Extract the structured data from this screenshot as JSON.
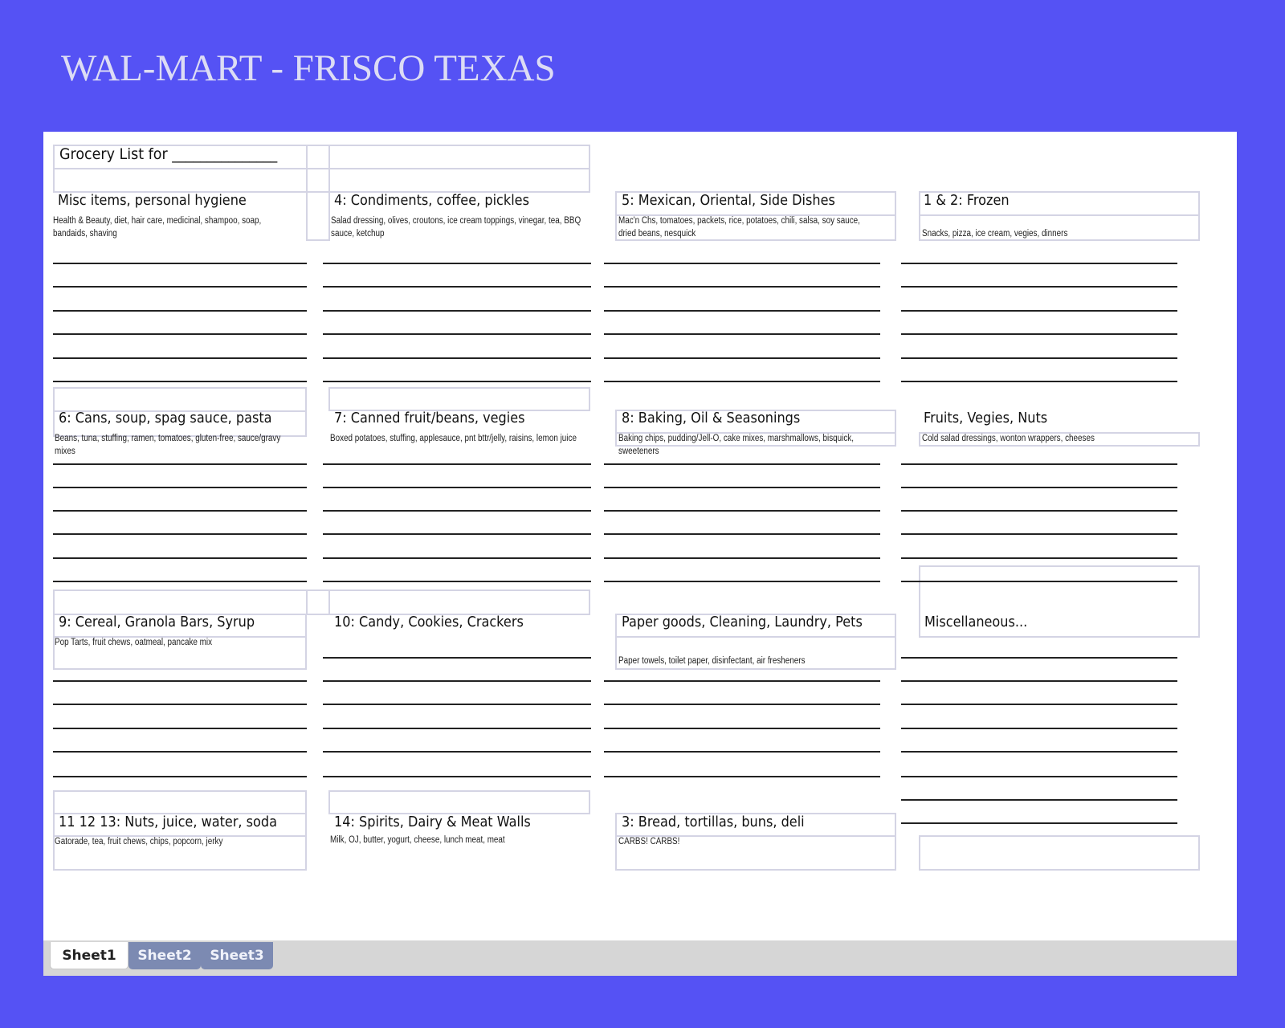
{
  "page_title": "WAL-MART - FRISCO TEXAS",
  "list_header": "Grocery List for _______________",
  "sections": {
    "misc_hygiene": {
      "title": "Misc items, personal hygiene",
      "desc": "Health & Beauty, diet, hair care, medicinal, shampoo, soap, bandaids, shaving"
    },
    "condiments": {
      "title": "4: Condiments, coffee, pickles",
      "desc": "Salad dressing, olives, croutons, ice cream toppings, vinegar, tea, BBQ sauce, ketchup"
    },
    "mexican": {
      "title": "5: Mexican, Oriental, Side Dishes",
      "desc": "Mac'n Chs, tomatoes, packets, rice, potatoes, chili, salsa, soy sauce, dried beans, nesquick"
    },
    "frozen": {
      "title": "1 & 2: Frozen",
      "desc": "Snacks, pizza, ice cream, vegies, dinners"
    },
    "cans": {
      "title": "6: Cans, soup, spag sauce, pasta",
      "desc": "Beans, tuna, stuffing, ramen, tomatoes, gluten-free, sauce/gravy mixes"
    },
    "canned_fruit": {
      "title": "7: Canned fruit/beans, vegies",
      "desc": "Boxed potatoes, stuffing, applesauce, pnt bttr/jelly, raisins, lemon juice"
    },
    "baking": {
      "title": "8: Baking, Oil & Seasonings",
      "desc": "Baking chips, pudding/Jell-O, cake mixes, marshmallows, bisquick, sweeteners"
    },
    "produce": {
      "title": "Fruits, Vegies, Nuts",
      "desc": "Cold salad dressings, wonton wrappers, cheeses"
    },
    "cereal": {
      "title": "9: Cereal, Granola Bars, Syrup",
      "desc": "Pop Tarts, fruit chews, oatmeal, pancake mix"
    },
    "candy": {
      "title": "10: Candy, Cookies, Crackers"
    },
    "paper": {
      "title": "Paper goods, Cleaning, Laundry, Pets",
      "desc": "Paper towels, toilet paper, disinfectant, air fresheners"
    },
    "miscellaneous": {
      "title": "Miscellaneous..."
    },
    "nuts_juice": {
      "title": "11 12 13: Nuts, juice, water, soda",
      "desc": "Gatorade, tea, fruit chews, chips, popcorn, jerky"
    },
    "spirits": {
      "title": "14: Spirits, Dairy & Meat Walls",
      "desc": "Milk, OJ, butter, yogurt, cheese, lunch meat, meat"
    },
    "bread": {
      "title": "3: Bread, tortillas, buns, deli",
      "desc": "CARBS! CARBS!"
    }
  },
  "tabs": [
    "Sheet1",
    "Sheet2",
    "Sheet3"
  ]
}
